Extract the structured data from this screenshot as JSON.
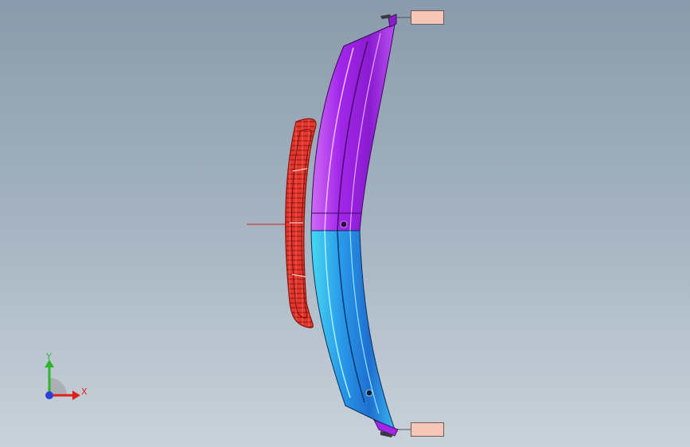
{
  "colors": {
    "background_top": "#8a9bab",
    "background_bottom": "#c9d2da",
    "label_fill": "#f6c7b8",
    "part_upper": "#a126e8",
    "part_upper_light": "#cf6bf6",
    "part_lower": "#2a86e0",
    "part_lower_light": "#46d9f2",
    "grille": "#e3362c",
    "axis_x": "#e0201c",
    "axis_y": "#2db52d",
    "axis_z": "#2a3fd8",
    "origin_line": "#d81c1c"
  },
  "labels": {
    "top_tag": "",
    "bottom_tag": ""
  },
  "triad": {
    "x_label": "X",
    "y_label": "Y",
    "icon": "coordinate-triad-icon"
  }
}
